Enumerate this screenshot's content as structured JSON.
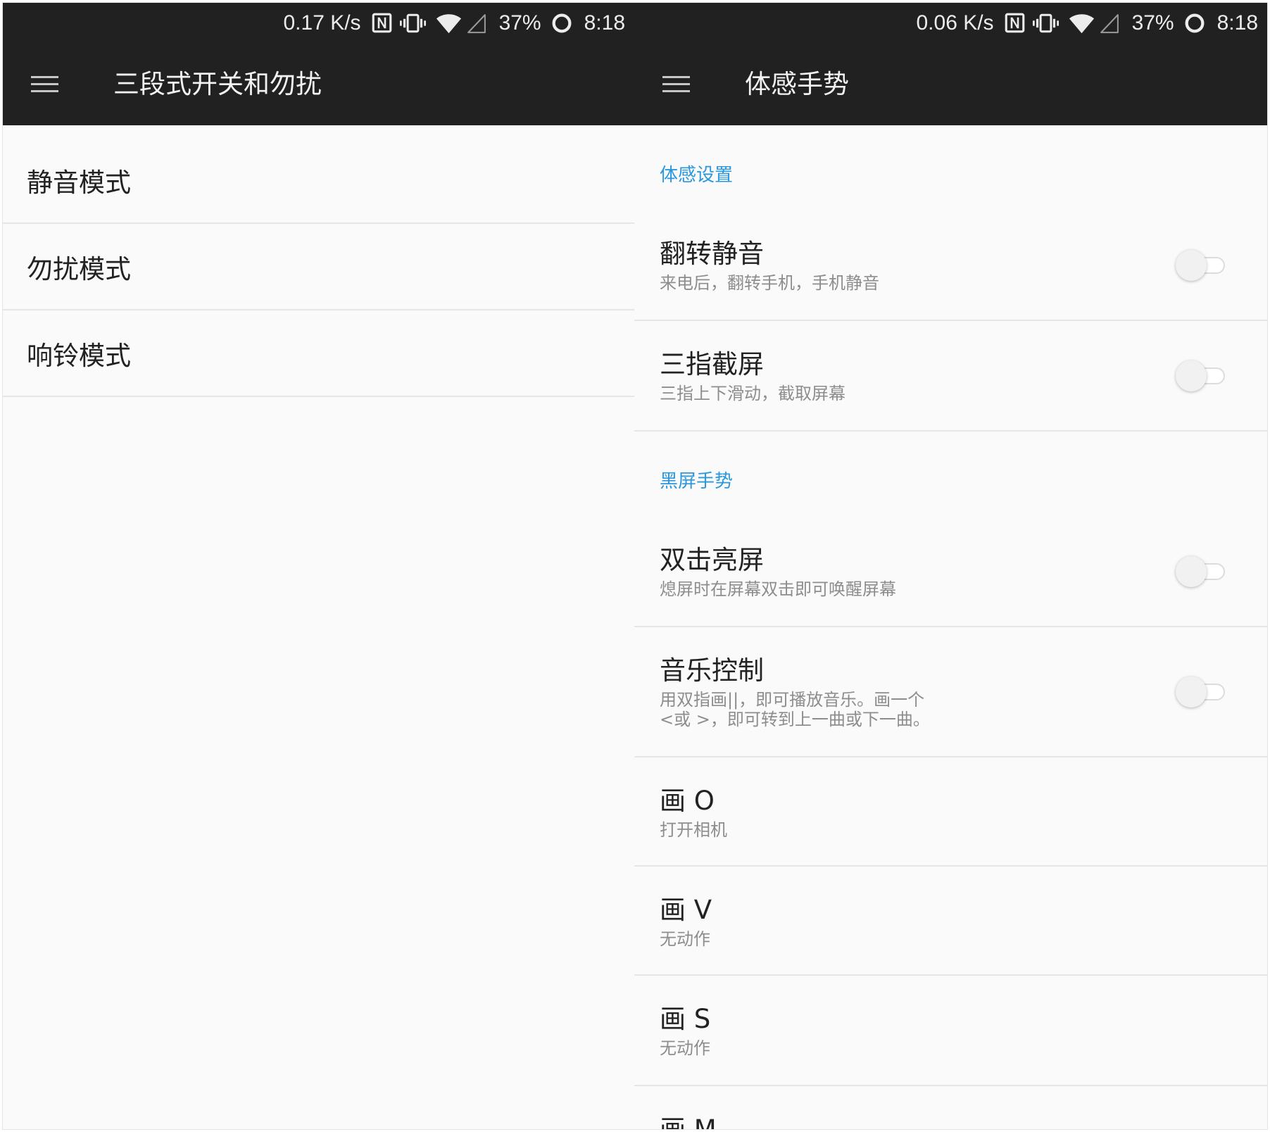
{
  "left_screen": {
    "status": {
      "speed": "0.17 K/s",
      "battery": "37%",
      "time": "8:18"
    },
    "title": "三段式开关和勿扰",
    "items": [
      {
        "title": "静音模式"
      },
      {
        "title": "勿扰模式"
      },
      {
        "title": "响铃模式"
      }
    ]
  },
  "right_screen": {
    "status": {
      "speed": "0.06 K/s",
      "battery": "37%",
      "time": "8:18"
    },
    "title": "体感手势",
    "sections": [
      {
        "header": "体感设置",
        "items": [
          {
            "title": "翻转静音",
            "subtitle": "来电后，翻转手机，手机静音",
            "toggle_on": false
          },
          {
            "title": "三指截屏",
            "subtitle": "三指上下滑动，截取屏幕",
            "toggle_on": false
          }
        ]
      },
      {
        "header": "黑屏手势",
        "items": [
          {
            "title": "双击亮屏",
            "subtitle": "熄屏时在屏幕双击即可唤醒屏幕",
            "toggle_on": false
          },
          {
            "title": "音乐控制",
            "subtitle": "用双指画||，即可播放音乐。画一个\n<或 >，即可转到上一曲或下一曲。",
            "toggle_on": false
          },
          {
            "title": "画 O",
            "subtitle": "打开相机"
          },
          {
            "title": "画 V",
            "subtitle": "无动作"
          },
          {
            "title": "画 S",
            "subtitle": "无动作"
          },
          {
            "title": "画 M"
          }
        ]
      }
    ]
  },
  "icons": {
    "menu": "menu-icon",
    "nfc": "nfc-icon",
    "vibrate": "vibrate-icon",
    "wifi": "wifi-icon",
    "signal": "signal-icon",
    "battery": "battery-icon"
  },
  "colors": {
    "app_bar": "#212121",
    "background": "#fafafa",
    "accent": "#2b97de",
    "primary_text": "#222222",
    "secondary_text": "#8d8d8d",
    "divider": "#e6e6e6"
  }
}
